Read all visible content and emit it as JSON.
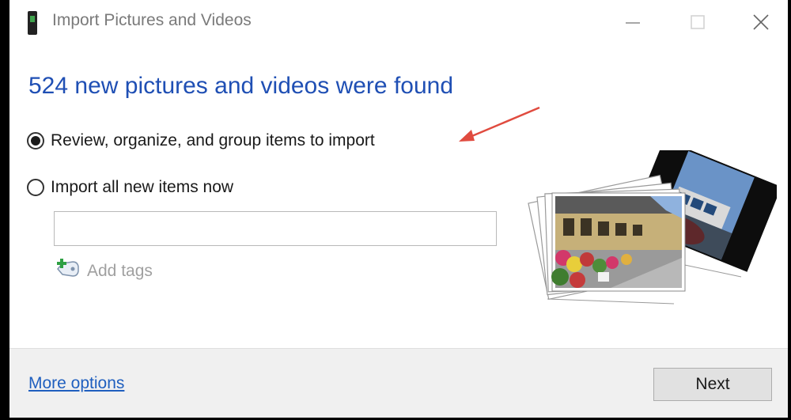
{
  "window": {
    "title": "Import Pictures and Videos",
    "controls": {
      "minimize": "—",
      "maximize": "☐",
      "close": "✕"
    }
  },
  "main": {
    "headline": "524 new pictures and videos were found",
    "options": [
      {
        "label": "Review, organize, and group items to import",
        "selected": true
      },
      {
        "label": "Import all new items now",
        "selected": false
      }
    ],
    "tags_input": {
      "value": "",
      "placeholder": ""
    },
    "add_tags_label": "Add tags"
  },
  "footer": {
    "more_options_label": "More options",
    "next_label": "Next"
  },
  "colors": {
    "headline": "#1f4fb4",
    "link": "#1f5fbf",
    "arrow": "#e04b3f",
    "footer_bg": "#f0f0f0"
  },
  "icons": {
    "app": "camera-device-icon",
    "add_tags": "tag-add-icon",
    "annotation": "red-arrow-icon",
    "illustration": "photo-stack-icon"
  }
}
